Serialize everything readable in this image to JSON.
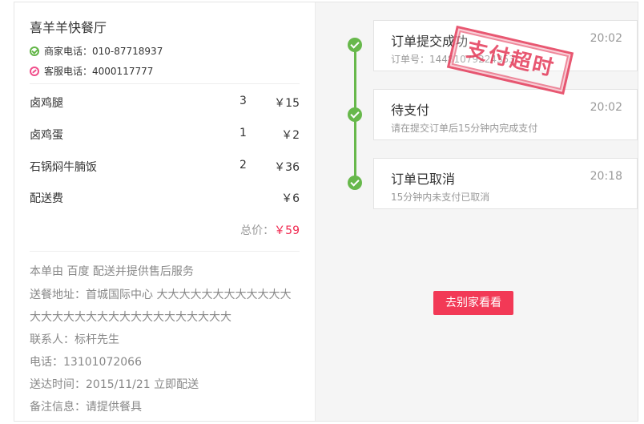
{
  "shop": {
    "name": "喜羊羊快餐厅",
    "merchant_phone_label": "商家电话：",
    "merchant_phone": "010-87718937",
    "service_phone_label": "客服电话：",
    "service_phone": "4000117777"
  },
  "items": [
    {
      "name": "卤鸡腿",
      "qty": "3",
      "price": "￥15"
    },
    {
      "name": "卤鸡蛋",
      "qty": "1",
      "price": "￥2"
    },
    {
      "name": "石锅焖牛腩饭",
      "qty": "2",
      "price": "￥36"
    },
    {
      "name": "配送费",
      "qty": "",
      "price": "￥6"
    }
  ],
  "total": {
    "label": "总价：",
    "amount": "￥59"
  },
  "info": {
    "service_note": "本单由 百度 配送并提供售后服务",
    "address_line1": "送餐地址：首城国际中心 大大大大大大大大大大大大",
    "address_line2": "大大大大大大大大大大大大大大大大大大",
    "contact": "联系人：标杆先生",
    "phone": "电话：13101072066",
    "delivery_time": "送达时间：2015/11/21 立即配送",
    "remark": "备注信息：请提供餐具"
  },
  "timeline": [
    {
      "title": "订单提交成功",
      "time": "20:02",
      "desc": "订单号：14481079224353"
    },
    {
      "title": "待支付",
      "time": "20:02",
      "desc": "请在提交订单后15分钟内完成支付"
    },
    {
      "title": "订单已取消",
      "time": "20:18",
      "desc": "15分钟内未支付已取消"
    }
  ],
  "stamp_text": "支付超时",
  "action_button": "去别家看看",
  "colors": {
    "accent": "#f23956",
    "success": "#67b84b",
    "price": "#f0284f"
  }
}
